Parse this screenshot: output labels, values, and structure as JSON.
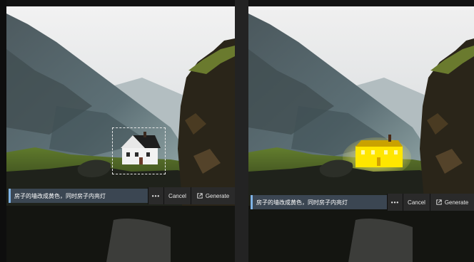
{
  "panels": [
    {
      "id": "before",
      "prompt_text": "房子的墙改成黄色，同时房子内亮灯",
      "more_label": "•••",
      "cancel_label": "Cancel",
      "generate_label": "Generate"
    },
    {
      "id": "after",
      "prompt_text": "房子的墙改成黄色，同时房子内亮灯",
      "more_label": "•••",
      "cancel_label": "Cancel",
      "generate_label": "Generate"
    }
  ],
  "colors": {
    "prompt_field_bg": "#3b4652",
    "prompt_accent": "#7fb3e6",
    "button_bg": "#2a2a2a",
    "house_before_walls": "#f2f2f2",
    "house_after_walls": "#ffe600"
  },
  "icons": {
    "more": "ellipsis-icon",
    "generate": "external-link-icon"
  }
}
